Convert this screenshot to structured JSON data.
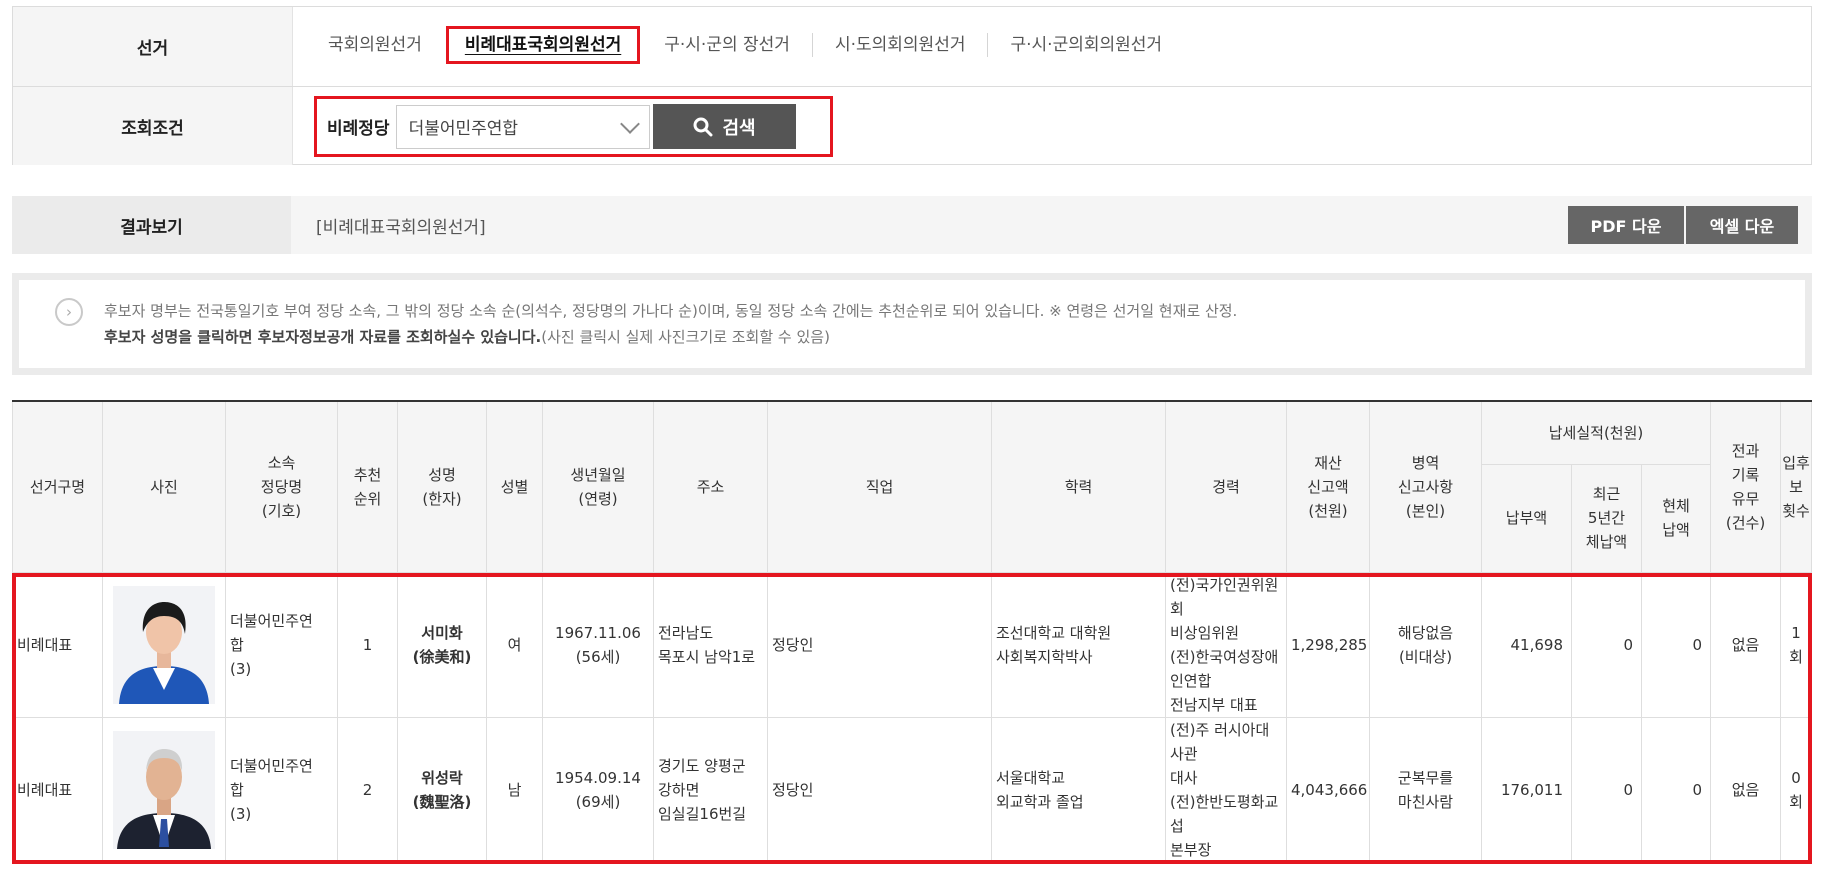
{
  "filter": {
    "election_label": "선거",
    "condition_label": "조회조건",
    "tabs": [
      {
        "label": "국회의원선거",
        "active": false
      },
      {
        "label": "비례대표국회의원선거",
        "active": true
      },
      {
        "label": "구·시·군의 장선거",
        "active": false
      },
      {
        "label": "시·도의회의원선거",
        "active": false
      },
      {
        "label": "구·시·군의회의원선거",
        "active": false
      }
    ],
    "party_label": "비례정당",
    "party_value": "더불어민주연합",
    "search_label": "검색"
  },
  "result": {
    "label": "결과보기",
    "text": "[비례대표국회의원선거]",
    "pdf_label": "PDF 다운",
    "excel_label": "엑셀 다운"
  },
  "notice": {
    "line1": "후보자 명부는 전국통일기호 부여 정당 소속, 그 밖의 정당 소속 순(의석수, 정당명의 가나다 순)이며, 동일 정당 소속 간에는 추천순위로 되어 있습니다. ※ 연령은 선거일 현재로 산정.",
    "line2_bold": "후보자 성명을 클릭하면 후보자정보공개 자료를 조회하실수 있습니다.",
    "line2_rest": "(사진 클릭시 실제 사진크기로 조회할 수 있음)"
  },
  "table": {
    "headers": {
      "election": "선거구명",
      "photo": "사진",
      "party": [
        "소속",
        "정당명",
        "(기호)"
      ],
      "rank": [
        "추천",
        "순위"
      ],
      "name": [
        "성명",
        "(한자)"
      ],
      "gender": "성별",
      "birth": [
        "생년월일",
        "(연령)"
      ],
      "address": "주소",
      "job": "직업",
      "education": "학력",
      "career": "경력",
      "assets": [
        "재산",
        "신고액",
        "(천원)"
      ],
      "military": [
        "병역",
        "신고사항",
        "(본인)"
      ],
      "tax_group": "납세실적(천원)",
      "tax_paid": "납부액",
      "tax_arrears5": [
        "최근",
        "5년간",
        "체납액"
      ],
      "tax_current": [
        "현체",
        "납액"
      ],
      "criminal": [
        "전과",
        "기록",
        "유무",
        "(건수)"
      ],
      "candidacy": [
        "입후보",
        "횟수"
      ]
    },
    "rows": [
      {
        "election": "비례대표",
        "photo_icon": "person-photo-female",
        "party": [
          "더불어민주연",
          "합",
          "(3)"
        ],
        "rank": "1",
        "name": "서미화",
        "hanja": "(徐美和)",
        "gender": "여",
        "birth": "1967.11.06",
        "age": "(56세)",
        "address": [
          "전라남도",
          "목포시 남악1로"
        ],
        "job": "정당인",
        "education": [
          "조선대학교 대학원",
          "사회복지학박사"
        ],
        "career": [
          "(전)국가인권위원회",
          "비상임위원",
          "(전)한국여성장애인연합",
          "전남지부 대표"
        ],
        "assets": "1,298,285",
        "military": [
          "해당없음",
          "(비대상)"
        ],
        "tax_paid": "41,698",
        "tax_arrears5": "0",
        "tax_current": "0",
        "criminal": "없음",
        "candidacy": "1회"
      },
      {
        "election": "비례대표",
        "photo_icon": "person-photo-male",
        "party": [
          "더불어민주연",
          "합",
          "(3)"
        ],
        "rank": "2",
        "name": "위성락",
        "hanja": "(魏聖洛)",
        "gender": "남",
        "birth": "1954.09.14",
        "age": "(69세)",
        "address": [
          "경기도 양평군",
          "강하면",
          "임실길16번길"
        ],
        "job": "정당인",
        "education": [
          "서울대학교",
          "외교학과 졸업"
        ],
        "career": [
          "(전)주 러시아대사관",
          "대사",
          "(전)한반도평화교섭",
          "본부장"
        ],
        "assets": "4,043,666",
        "military": [
          "군복무를",
          "마친사람"
        ],
        "tax_paid": "176,011",
        "tax_arrears5": "0",
        "tax_current": "0",
        "criminal": "없음",
        "candidacy": "0회"
      }
    ]
  },
  "colors": {
    "highlight": "#e4161f",
    "button": "#555555",
    "label_bg": "#f5f5f5"
  }
}
